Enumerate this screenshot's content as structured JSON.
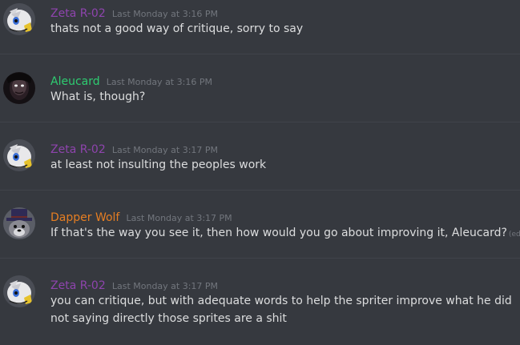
{
  "colors": {
    "background": "#36393f",
    "text": "#dcddde",
    "timestamp": "#72767d",
    "zeta": "#8e44ad",
    "aleucard": "#2ecc71",
    "dapper": "#e67e22"
  },
  "messages": [
    {
      "author": "Zeta R-02",
      "timestamp": "Last Monday at 3:16 PM",
      "avatar_icon": "cartoon-character-avatar-icon",
      "lines": [
        "thats not a good way of critique, sorry to say"
      ]
    },
    {
      "author": "Aleucard",
      "timestamp": "Last Monday at 3:16 PM",
      "avatar_icon": "dark-figure-avatar-icon",
      "lines": [
        "What is, though?"
      ]
    },
    {
      "author": "Zeta R-02",
      "timestamp": "Last Monday at 3:17 PM",
      "avatar_icon": "cartoon-character-avatar-icon",
      "lines": [
        "at least not insulting the peoples work"
      ]
    },
    {
      "author": "Dapper Wolf",
      "timestamp": "Last Monday at 3:17 PM",
      "avatar_icon": "top-hat-wolf-avatar-icon",
      "lines": [
        "If that's the way you see it, then how would you go about improving it, Aleucard?"
      ],
      "edited_label": "(edited)"
    },
    {
      "author": "Zeta R-02",
      "timestamp": "Last Monday at 3:17 PM",
      "avatar_icon": "cartoon-character-avatar-icon",
      "lines": [
        "you can critique, but with adequate words to help the spriter improve what he did",
        "not saying directly those sprites are a shit"
      ]
    }
  ]
}
